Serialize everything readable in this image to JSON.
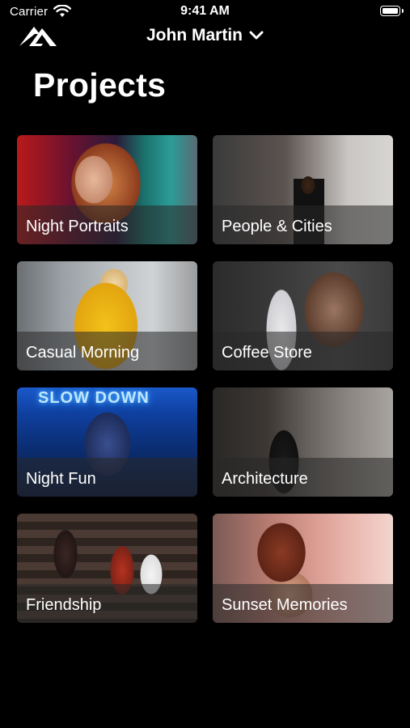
{
  "status_bar": {
    "carrier": "Carrier",
    "time": "9:41 AM",
    "battery_level": 1.0
  },
  "nav": {
    "logo_icon": "mountain-logo-icon",
    "user_name": "John Martin",
    "chevron_icon": "chevron-down-icon"
  },
  "page": {
    "title": "Projects"
  },
  "projects": [
    {
      "label": "Night Portraits"
    },
    {
      "label": "People & Cities"
    },
    {
      "label": "Casual Morning"
    },
    {
      "label": "Coffee Store"
    },
    {
      "label": "Night Fun",
      "photo_text": "SLOW DOWN"
    },
    {
      "label": "Architecture"
    },
    {
      "label": "Friendship"
    },
    {
      "label": "Sunset Memories"
    }
  ],
  "colors": {
    "background": "#000000",
    "text": "#ffffff",
    "caption_band": "rgba(40,40,40,0.55)"
  }
}
